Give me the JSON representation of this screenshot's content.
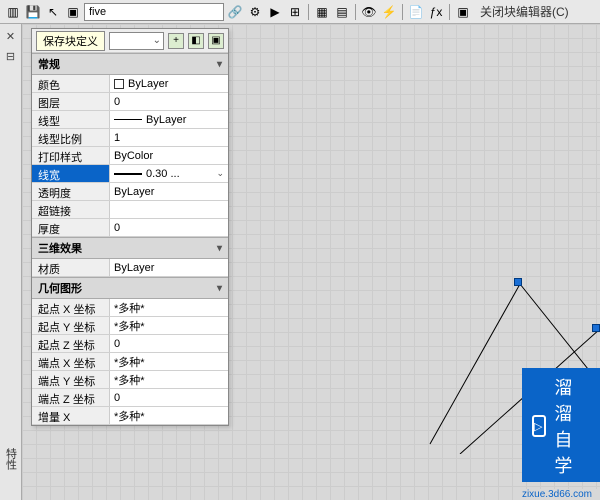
{
  "toolbar": {
    "name_value": "five",
    "close_editor_label": "关闭块编辑器(C)",
    "tooltip": "保存块定义"
  },
  "panel": {
    "dropdown_arrow": "⌄",
    "sections": {
      "general": {
        "title": "常规",
        "rows": {
          "color": {
            "label": "颜色",
            "value": "ByLayer"
          },
          "layer": {
            "label": "图层",
            "value": "0"
          },
          "linetype": {
            "label": "线型",
            "value": "ByLayer"
          },
          "ltscale": {
            "label": "线型比例",
            "value": "1"
          },
          "plotstyle": {
            "label": "打印样式",
            "value": "ByColor"
          },
          "lineweight": {
            "label": "线宽",
            "value": "0.30 ..."
          },
          "transparency": {
            "label": "透明度",
            "value": "ByLayer"
          },
          "hyperlink": {
            "label": "超链接",
            "value": ""
          },
          "thickness": {
            "label": "厚度",
            "value": "0"
          }
        }
      },
      "visual3d": {
        "title": "三维效果",
        "rows": {
          "material": {
            "label": "材质",
            "value": "ByLayer"
          }
        }
      },
      "geometry": {
        "title": "几何图形",
        "rows": {
          "startx": {
            "label": "起点 X 坐标",
            "value": "*多种*"
          },
          "starty": {
            "label": "起点 Y 坐标",
            "value": "*多种*"
          },
          "startz": {
            "label": "起点 Z 坐标",
            "value": "0"
          },
          "endx": {
            "label": "端点 X 坐标",
            "value": "*多种*"
          },
          "endy": {
            "label": "端点 Y 坐标",
            "value": "*多种*"
          },
          "endz": {
            "label": "端点 Z 坐标",
            "value": "0"
          },
          "deltax": {
            "label": "增量 X",
            "value": "*多种*"
          }
        }
      }
    }
  },
  "left_rail": {
    "label": "特性"
  },
  "watermark": {
    "text": "溜溜自学",
    "url": "zixue.3d66.com"
  }
}
